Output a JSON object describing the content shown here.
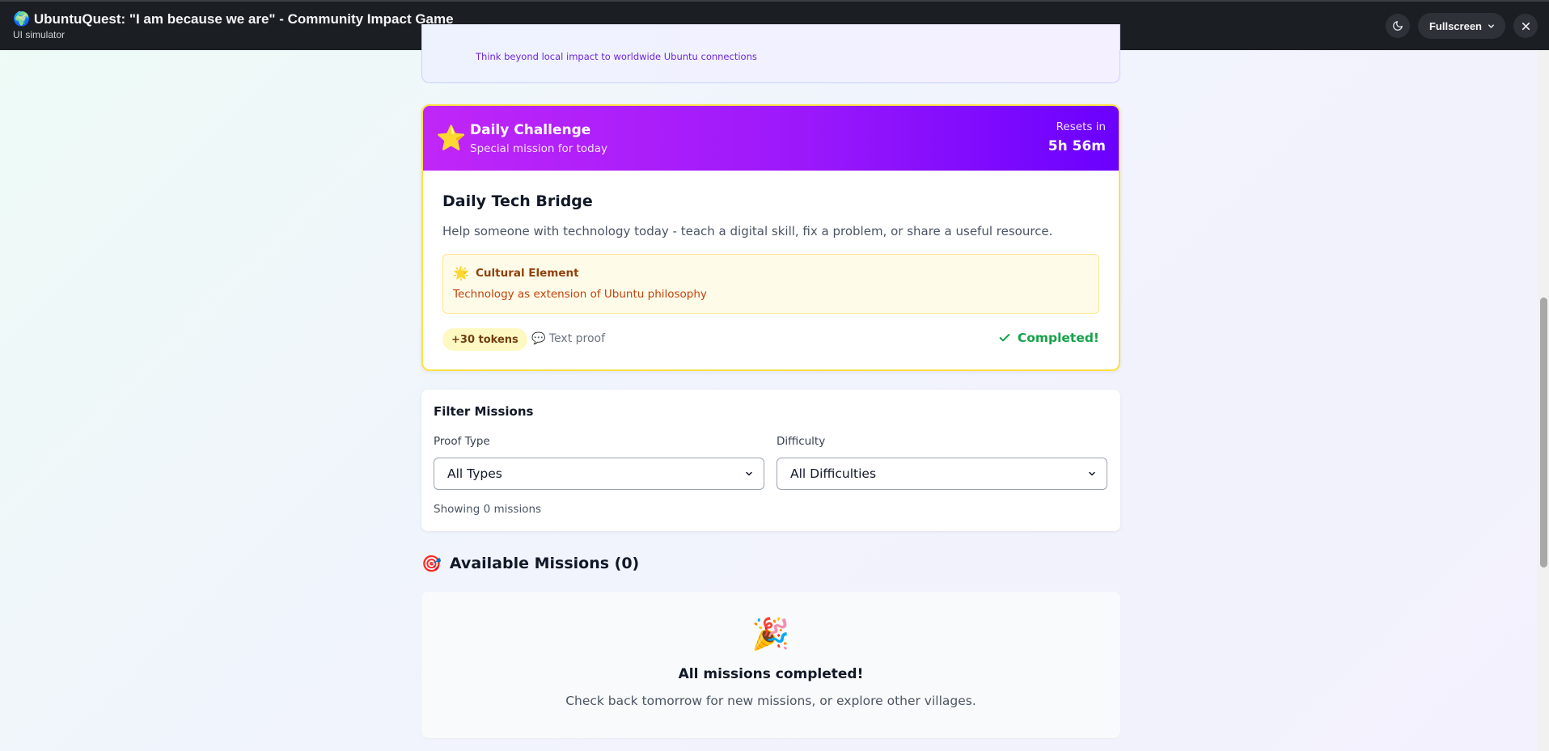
{
  "topbar": {
    "title": "🌍 UbuntuQuest: \"I am because we are\" - Community Impact Game",
    "subtitle": "UI simulator",
    "theme_icon": "moon-icon",
    "fullscreen_label": "Fullscreen",
    "close_icon": "close-icon"
  },
  "previous_card": {
    "text": "Think beyond local impact to worldwide Ubuntu connections"
  },
  "daily_challenge": {
    "icon": "⭐",
    "title": "Daily Challenge",
    "subtitle": "Special mission for today",
    "resets_label": "Resets in",
    "resets_value": "5h 56m",
    "mission_title": "Daily Tech Bridge",
    "mission_description": "Help someone with technology today - teach a digital skill, fix a problem, or share a useful resource.",
    "cultural_icon": "🌟",
    "cultural_title": "Cultural Element",
    "cultural_text": "Technology as extension of Ubuntu philosophy",
    "tokens": "+30 tokens",
    "proof": "💬 Text proof",
    "status": "Completed!",
    "accent_color": "#9b18fb",
    "border_color": "#fde047"
  },
  "filter": {
    "title": "Filter Missions",
    "proof_type_label": "Proof Type",
    "proof_type_value": "All Types",
    "difficulty_label": "Difficulty",
    "difficulty_value": "All Difficulties",
    "count_text": "Showing 0 missions"
  },
  "available": {
    "icon": "🎯",
    "title": "Available Missions (0)"
  },
  "empty_state": {
    "icon": "🎉",
    "title": "All missions completed!",
    "subtitle": "Check back tomorrow for new missions, or explore other villages."
  }
}
